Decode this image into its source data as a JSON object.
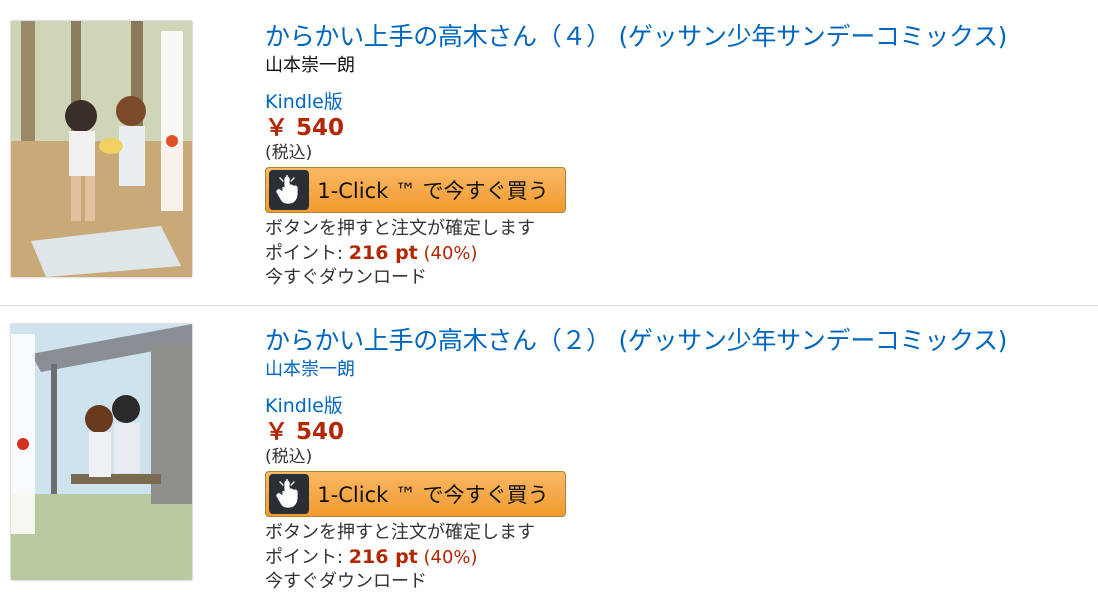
{
  "results": [
    {
      "title": "からかい上手の高木さん（４） (ゲッサン少年サンデーコミックス)",
      "author": "山本崇一朗",
      "format": "Kindle版",
      "price": "￥ 540",
      "tax": "(税込)",
      "buy_label": "1-Click ™ で今すぐ買う",
      "note": "ボタンを押すと注文が確定します",
      "points_label": "ポイント: ",
      "points_value": "216 pt",
      "points_percent": "(40%)",
      "download": "今すぐダウンロード",
      "cover_icon": "book-cover-volume-4"
    },
    {
      "title": "からかい上手の高木さん（２） (ゲッサン少年サンデーコミックス)",
      "author": "山本崇一朗",
      "format": "Kindle版",
      "price": "￥ 540",
      "tax": "(税込)",
      "buy_label": "1-Click ™ で今すぐ買う",
      "note": "ボタンを押すと注文が確定します",
      "points_label": "ポイント: ",
      "points_value": "216 pt",
      "points_percent": "(40%)",
      "download": "今すぐダウンロード",
      "cover_icon": "book-cover-volume-2"
    }
  ],
  "colors": {
    "link": "#0066c0",
    "price": "#b12704",
    "button_top": "#f9b866",
    "button_bottom": "#f29a2e"
  }
}
